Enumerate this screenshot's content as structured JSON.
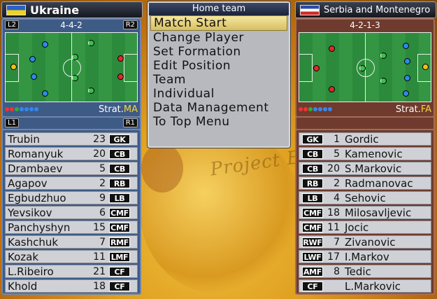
{
  "home": {
    "team_name": "Ukraine",
    "flag_colors": [
      "#2a62c8",
      "#f2d21a"
    ],
    "formation": "4-4-2",
    "left_tag": "L2",
    "right_tag": "R2",
    "strat_prefix": "Strat.",
    "strat_value": "MA",
    "roster_left_tag": "L1",
    "roster_right_tag": "R1",
    "players": [
      {
        "name": "Trubin",
        "number": "23",
        "position": "GK"
      },
      {
        "name": "Romanyuk",
        "number": "20",
        "position": "CB"
      },
      {
        "name": "Drambaev",
        "number": "5",
        "position": "CB"
      },
      {
        "name": "Agapov",
        "number": "2",
        "position": "RB"
      },
      {
        "name": "Egbudzhuo",
        "number": "9",
        "position": "LB"
      },
      {
        "name": "Yevsikov",
        "number": "6",
        "position": "CMF"
      },
      {
        "name": "Panchyshyn",
        "number": "15",
        "position": "CMF"
      },
      {
        "name": "Kashchuk",
        "number": "7",
        "position": "RMF"
      },
      {
        "name": "Kozak",
        "number": "11",
        "position": "LMF"
      },
      {
        "name": "L.Ribeiro",
        "number": "21",
        "position": "CF"
      },
      {
        "name": "Khold",
        "number": "18",
        "position": "CF"
      }
    ]
  },
  "away": {
    "team_name": "Serbia and Montenegro",
    "flag_colors": [
      "#d22a2a",
      "#2a4aa8",
      "#ffffff"
    ],
    "formation": "4-2-1-3",
    "strat_prefix": "Strat.",
    "strat_value": "FA",
    "players": [
      {
        "position": "GK",
        "number": "1",
        "name": "Gordic"
      },
      {
        "position": "CB",
        "number": "5",
        "name": "Kamenovic"
      },
      {
        "position": "CB",
        "number": "20",
        "name": "S.Markovic"
      },
      {
        "position": "RB",
        "number": "2",
        "name": "Radmanovac"
      },
      {
        "position": "LB",
        "number": "4",
        "name": "Sehovic"
      },
      {
        "position": "CMF",
        "number": "18",
        "name": "Milosavljevic"
      },
      {
        "position": "CMF",
        "number": "11",
        "name": "Jocic"
      },
      {
        "position": "RWF",
        "number": "7",
        "name": "Zivanovic"
      },
      {
        "position": "LWF",
        "number": "17",
        "name": "I.Markov"
      },
      {
        "position": "AMF",
        "number": "8",
        "name": "Tedic"
      },
      {
        "position": "CF",
        "number": "",
        "name": "L.Markovic"
      }
    ]
  },
  "menu": {
    "title": "Home team",
    "items": [
      "Match Start",
      "Change Player",
      "Set Formation",
      "Edit Position",
      "Team",
      "Individual",
      "Data Management",
      "To Top Menu"
    ],
    "selected_index": 0
  },
  "background_text": "Project Edge"
}
